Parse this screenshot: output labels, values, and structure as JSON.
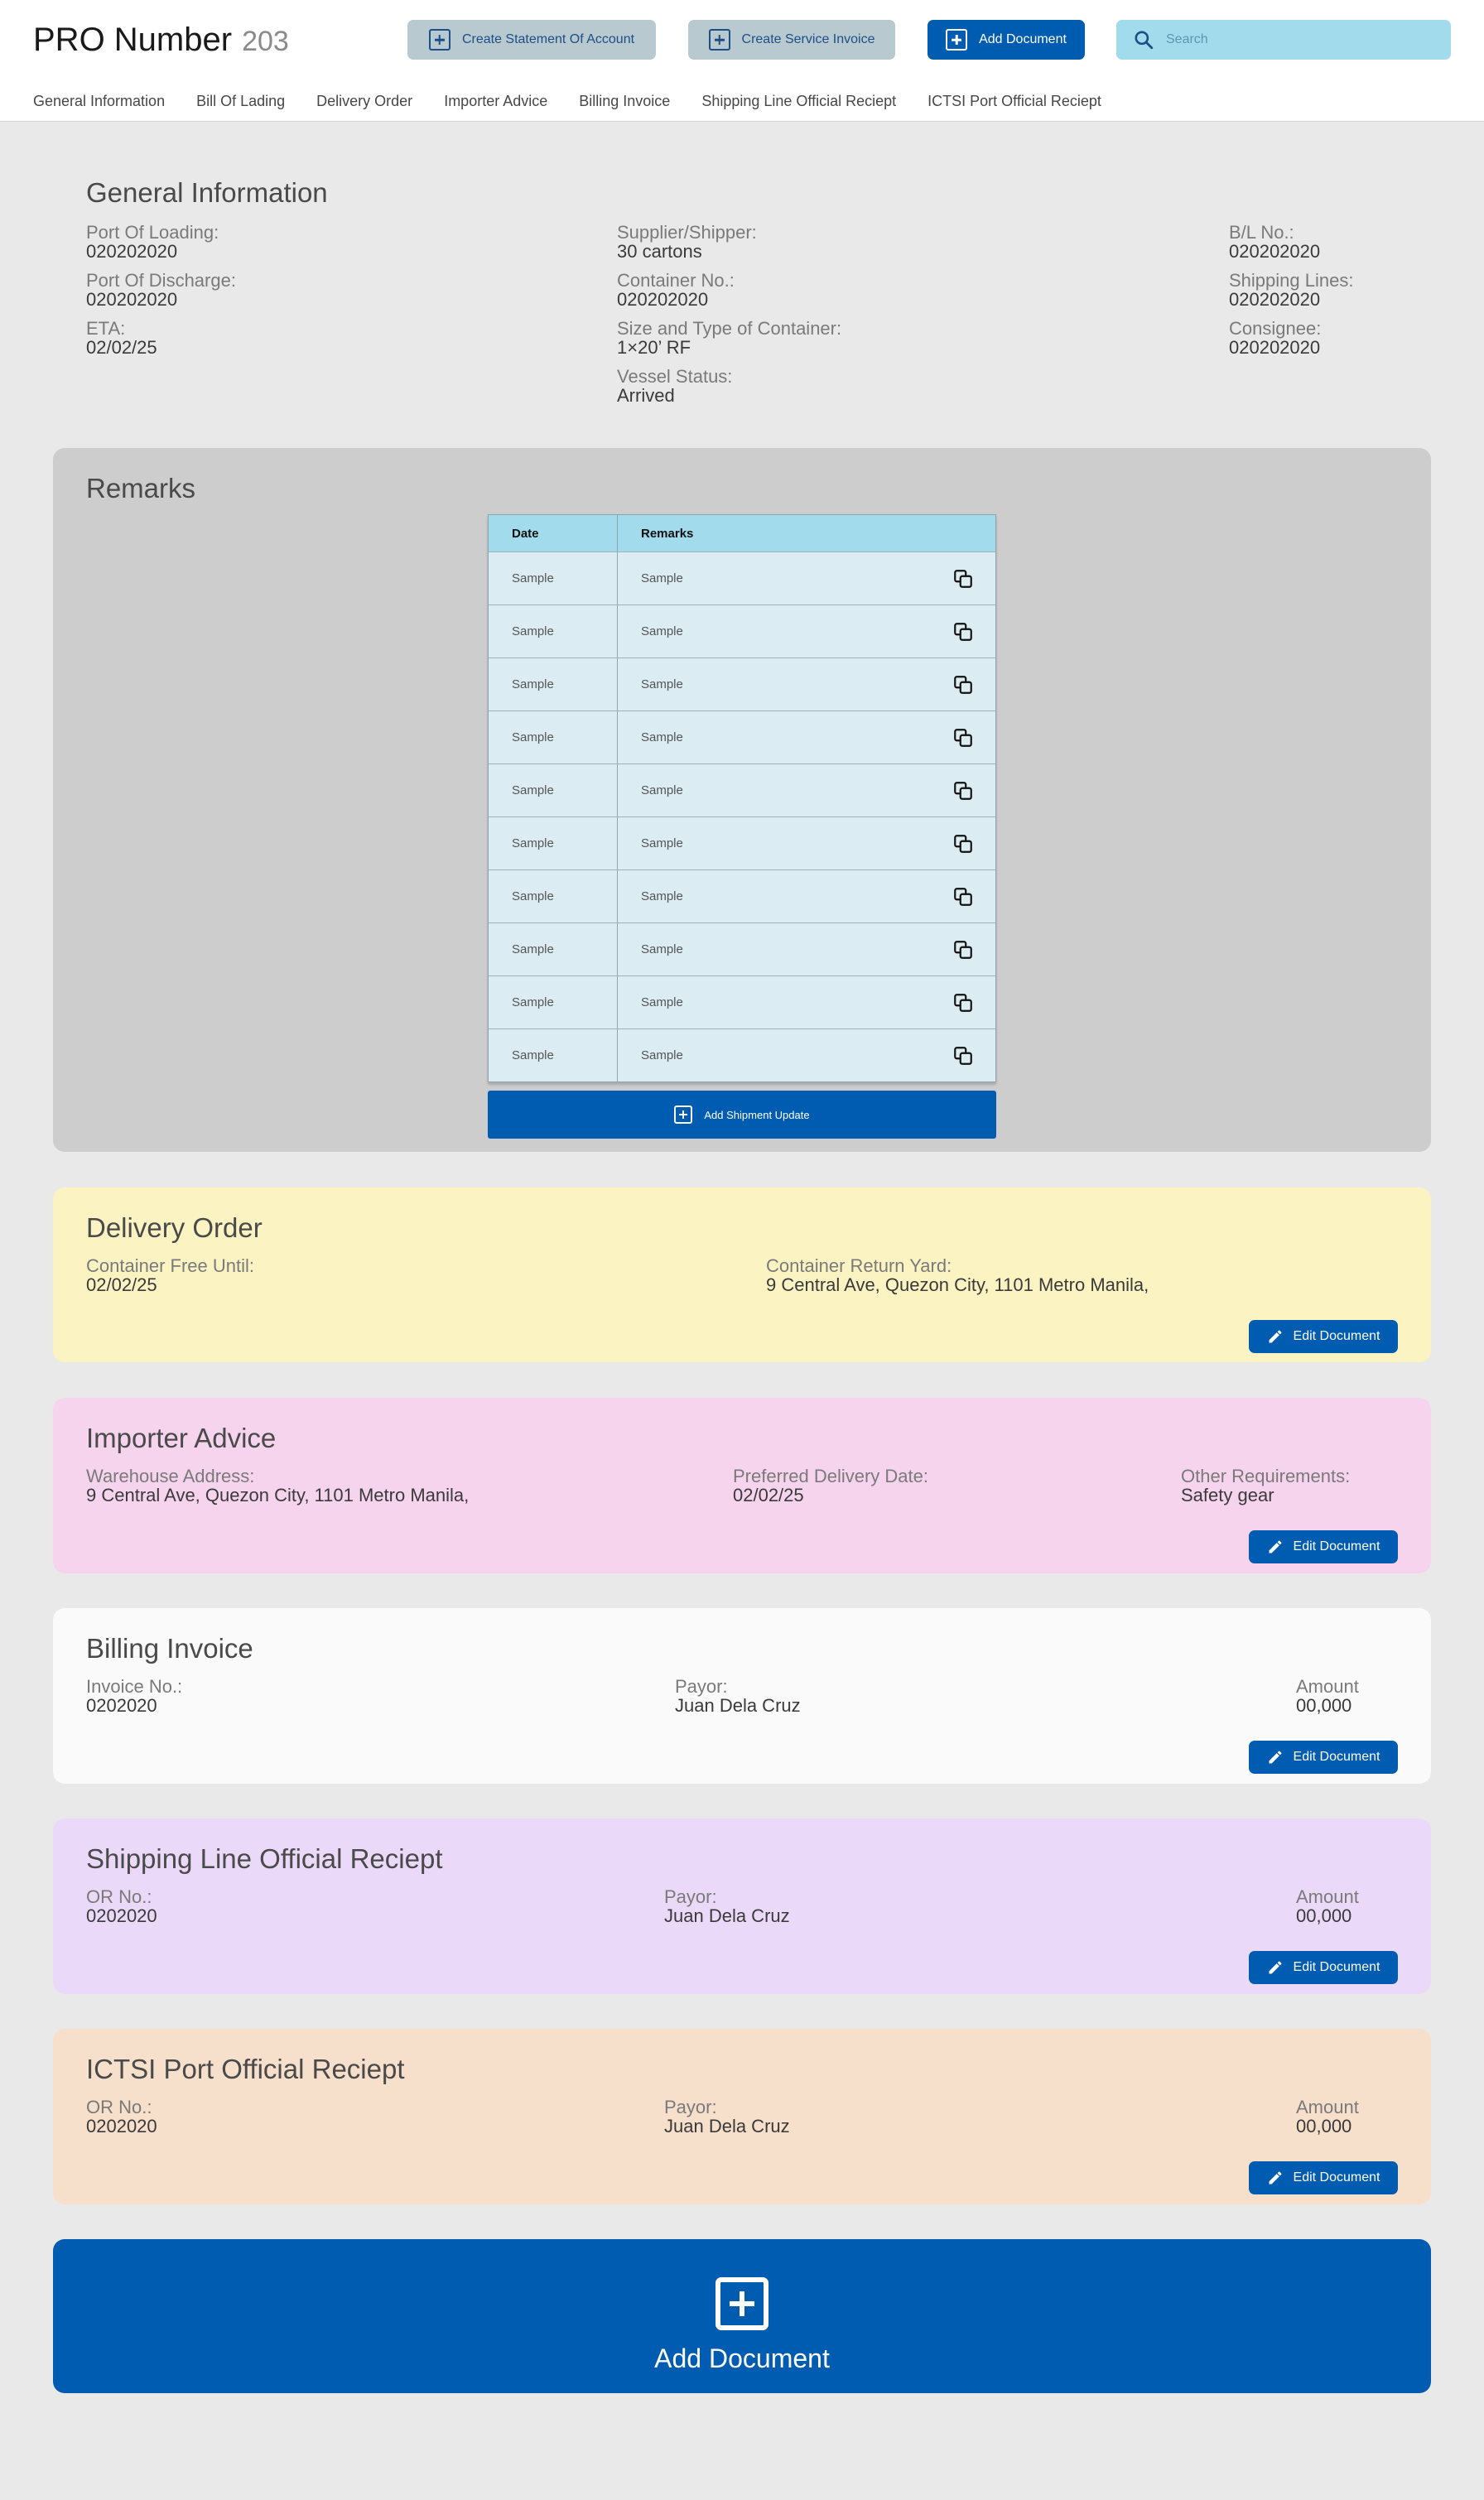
{
  "header": {
    "title": "PRO Number",
    "pro_number": "203",
    "buttons": {
      "create_soa": "Create Statement Of Account",
      "create_service_invoice": "Create Service Invoice",
      "add_document": "Add Document"
    },
    "search_placeholder": "Search"
  },
  "tabs": [
    "General Information",
    "Bill Of Lading",
    "Delivery Order",
    "Importer Advice",
    "Billing Invoice",
    "Shipping Line Official Reciept",
    "ICTSI Port Official Reciept"
  ],
  "general_information": {
    "title": "General Information",
    "fields": {
      "port_of_loading": {
        "label": "Port Of Loading:",
        "value": "020202020"
      },
      "port_of_discharge": {
        "label": "Port Of Discharge:",
        "value": "020202020"
      },
      "eta": {
        "label": "ETA:",
        "value": "02/02/25"
      },
      "supplier_shipper": {
        "label": "Supplier/Shipper:",
        "value": "30 cartons"
      },
      "container_no": {
        "label": "Container No.:",
        "value": "020202020"
      },
      "size_type": {
        "label": "Size and Type of Container:",
        "value": "1×20’ RF"
      },
      "vessel_status": {
        "label": "Vessel Status:",
        "value": "Arrived"
      },
      "bl_no": {
        "label": "B/L No.:",
        "value": "020202020"
      },
      "shipping_lines": {
        "label": "Shipping Lines:",
        "value": "020202020"
      },
      "consignee": {
        "label": "Consignee:",
        "value": "020202020"
      }
    }
  },
  "remarks": {
    "title": "Remarks",
    "columns": [
      "Date",
      "Remarks"
    ],
    "rows": [
      {
        "date": "Sample",
        "remark": "Sample"
      },
      {
        "date": "Sample",
        "remark": "Sample"
      },
      {
        "date": "Sample",
        "remark": "Sample"
      },
      {
        "date": "Sample",
        "remark": "Sample"
      },
      {
        "date": "Sample",
        "remark": "Sample"
      },
      {
        "date": "Sample",
        "remark": "Sample"
      },
      {
        "date": "Sample",
        "remark": "Sample"
      },
      {
        "date": "Sample",
        "remark": "Sample"
      },
      {
        "date": "Sample",
        "remark": "Sample"
      },
      {
        "date": "Sample",
        "remark": "Sample"
      }
    ],
    "add_button": "Add Shipment Update"
  },
  "delivery_order": {
    "title": "Delivery Order",
    "container_free_until": {
      "label": "Container Free Until:",
      "value": "02/02/25"
    },
    "container_return_yard": {
      "label": "Container Return Yard:",
      "value": "9 Central Ave, Quezon City, 1101 Metro Manila,"
    },
    "edit": "Edit Document"
  },
  "importer_advice": {
    "title": "Importer Advice",
    "warehouse_address": {
      "label": "Warehouse Address:",
      "value": "9 Central Ave, Quezon City, 1101 Metro Manila,"
    },
    "preferred_delivery_date": {
      "label": "Preferred Delivery Date:",
      "value": "02/02/25"
    },
    "other_requirements": {
      "label": "Other Requirements:",
      "value": "Safety gear"
    },
    "edit": "Edit Document"
  },
  "billing_invoice": {
    "title": "Billing Invoice",
    "invoice_no": {
      "label": "Invoice No.:",
      "value": "0202020"
    },
    "payor": {
      "label": "Payor:",
      "value": "Juan Dela Cruz"
    },
    "amount": {
      "label": "Amount",
      "value": "00,000"
    },
    "edit": "Edit Document"
  },
  "shipping_line_or": {
    "title": "Shipping Line Official Reciept",
    "or_no": {
      "label": "OR No.:",
      "value": "0202020"
    },
    "payor": {
      "label": "Payor:",
      "value": "Juan Dela Cruz"
    },
    "amount": {
      "label": "Amount",
      "value": "00,000"
    },
    "edit": "Edit Document"
  },
  "ictsi_or": {
    "title": "ICTSI Port Official Reciept",
    "or_no": {
      "label": "OR No.:",
      "value": "0202020"
    },
    "payor": {
      "label": "Payor:",
      "value": "Juan Dela Cruz"
    },
    "amount": {
      "label": "Amount",
      "value": "00,000"
    },
    "edit": "Edit Document"
  },
  "add_document_big": "Add Document",
  "colors": {
    "primary": "#005cb0",
    "header_button_gray": "#b9c9d0",
    "search_bg": "#a2dbec",
    "remarks_bg": "#cdcdcd",
    "delivery_order_bg": "#fbf4c2",
    "importer_advice_bg": "#f7d4ed",
    "billing_invoice_bg": "#fafafa",
    "shipping_line_bg": "#ebd9fa",
    "ictsi_bg": "#f6dfcb"
  }
}
